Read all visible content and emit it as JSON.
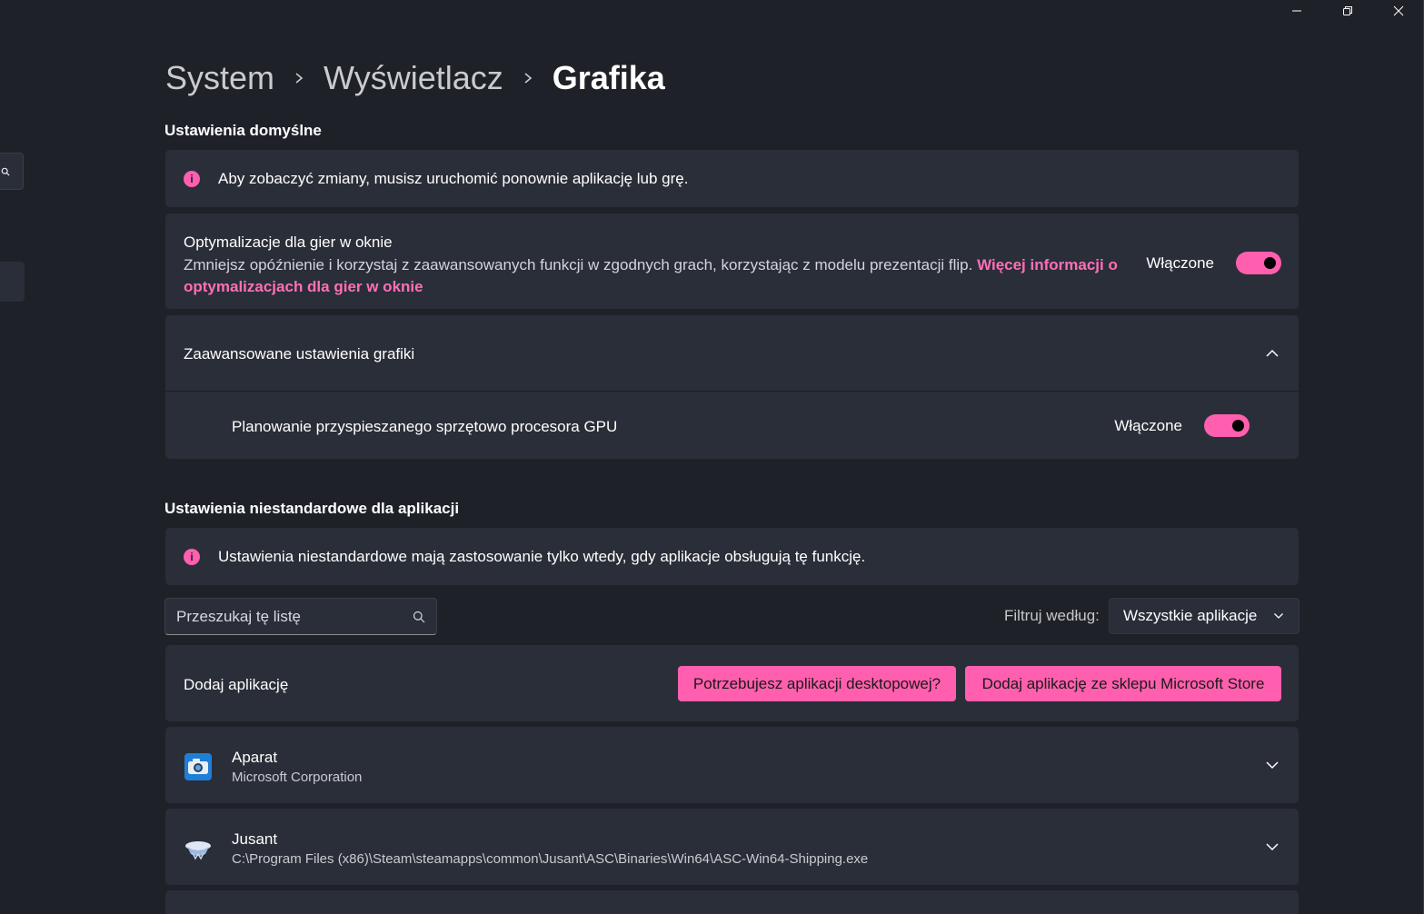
{
  "breadcrumb": {
    "items": [
      "System",
      "Wyświetlacz"
    ],
    "current": "Grafika"
  },
  "defaults": {
    "section_title": "Ustawienia domyślne",
    "info_text": "Aby zobaczyć zmiany, musisz uruchomić ponownie aplikację lub grę.",
    "windowed_opt": {
      "title": "Optymalizacje dla gier w oknie",
      "description": "Zmniejsz opóźnienie i korzystaj z zaawansowanych funkcji w zgodnych grach, korzystając z modelu prezentacji flip.",
      "link": "Więcej informacji o optymalizacjach dla gier w oknie",
      "state_label": "Włączone",
      "enabled": true
    },
    "advanced": {
      "title": "Zaawansowane ustawienia grafiki",
      "gpu_scheduling_label": "Planowanie przyspieszanego sprzętowo procesora GPU",
      "gpu_state_label": "Włączone",
      "gpu_enabled": true
    }
  },
  "custom": {
    "section_title": "Ustawienia niestandardowe dla aplikacji",
    "info_text": "Ustawienia niestandardowe mają zastosowanie tylko wtedy, gdy aplikacje obsługują tę funkcję.",
    "search_placeholder": "Przeszukaj tę listę",
    "filter_label": "Filtruj według:",
    "filter_value": "Wszystkie aplikacje",
    "add_apps": {
      "title": "Dodaj aplikację",
      "desktop_button": "Potrzebujesz aplikacji desktopowej?",
      "store_button": "Dodaj aplikację ze sklepu Microsoft Store"
    },
    "apps": [
      {
        "name": "Aparat",
        "subtitle": "Microsoft Corporation",
        "icon": "camera-app-icon"
      },
      {
        "name": "Jusant",
        "subtitle": "C:\\Program Files (x86)\\Steam\\steamapps\\common\\Jusant\\ASC\\Binaries\\Win64\\ASC-Win64-Shipping.exe",
        "icon": "jusant-app-icon"
      }
    ]
  },
  "colors": {
    "background": "#1f2128",
    "card": "#2a2e38",
    "accent": "#ff5fae"
  }
}
